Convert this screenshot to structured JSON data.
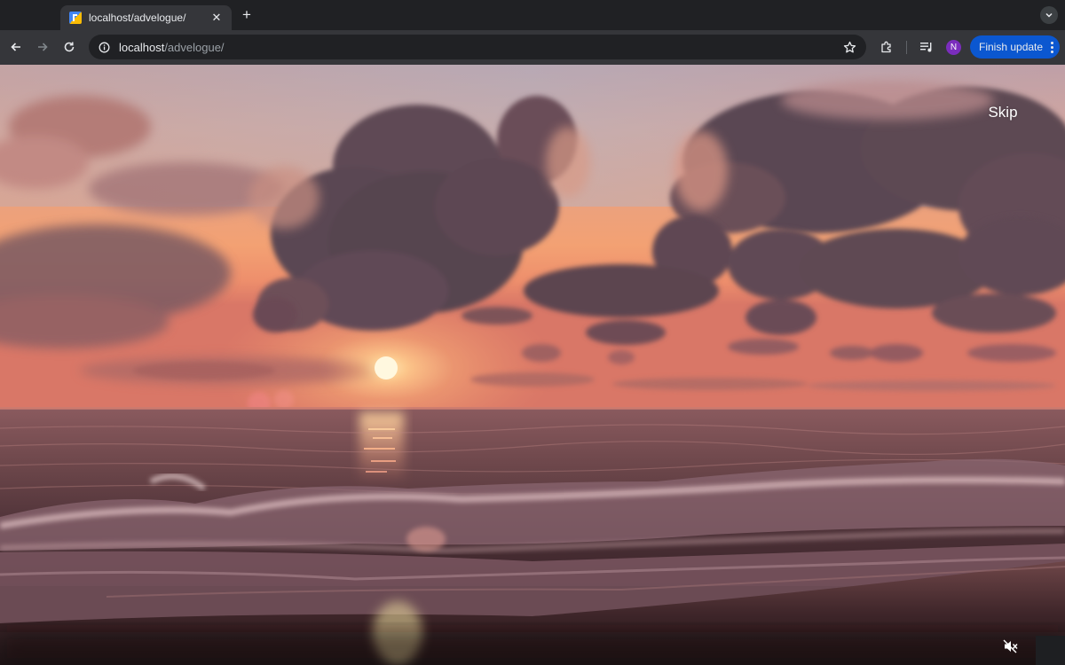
{
  "browser": {
    "tab": {
      "title": "localhost/advelogue/"
    },
    "address_bar": {
      "host": "localhost",
      "path": "/advelogue/"
    },
    "profile_initial": "N",
    "update_button": {
      "label": "Finish update"
    }
  },
  "page": {
    "skip_label": "Skip"
  },
  "icons": {
    "back": "arrow-left-icon",
    "forward": "arrow-right-icon",
    "reload": "reload-icon",
    "site_info": "info-icon",
    "bookmark": "star-icon",
    "extensions": "puzzle-icon",
    "media": "media-control-icon",
    "sound": "muted-speaker-icon"
  },
  "colors": {
    "accent": "#0b57d0",
    "avatar": "#7b2dbd"
  }
}
